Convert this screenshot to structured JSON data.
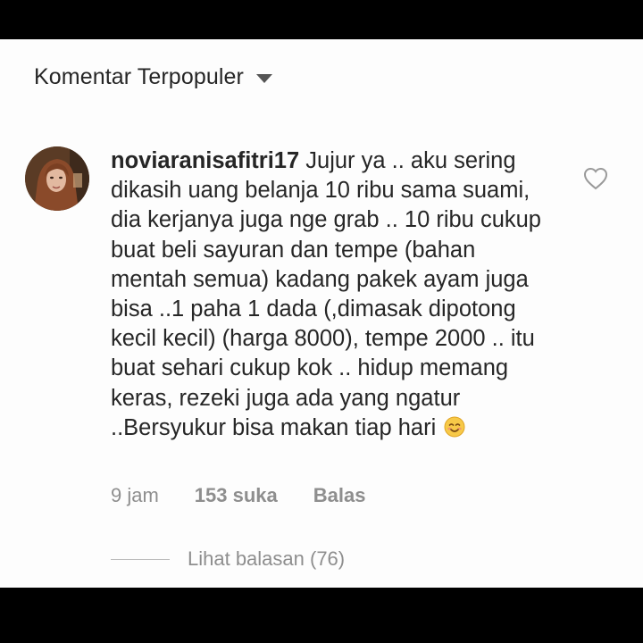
{
  "header": {
    "sort_label": "Komentar Terpopuler",
    "sort_icon": "caret-down-icon"
  },
  "comment": {
    "username": "noviaranisafitri17",
    "text": "Jujur ya .. aku sering dikasih uang belanja 10 ribu sama suami, dia kerjanya juga nge grab .. 10 ribu cukup buat beli sayuran dan tempe (bahan mentah semua) kadang pakek ayam juga bisa ..1 paha 1 dada (,dimasak dipotong kecil kecil) (harga 8000), tempe 2000 .. itu buat sehari cukup kok .. hidup memang keras, rezeki juga ada yang ngatur ..Bersyukur bisa makan tiap hari",
    "emoji": "smiling-face-icon",
    "like_icon": "heart-outline-icon",
    "time": "9 jam",
    "likes": "153 suka",
    "reply_label": "Balas"
  },
  "replies": {
    "view_label": "Lihat balasan (76)"
  },
  "colors": {
    "text": "#262626",
    "secondary": "#8e8e8e",
    "background": "#fdfdfd",
    "border": "#000000"
  }
}
